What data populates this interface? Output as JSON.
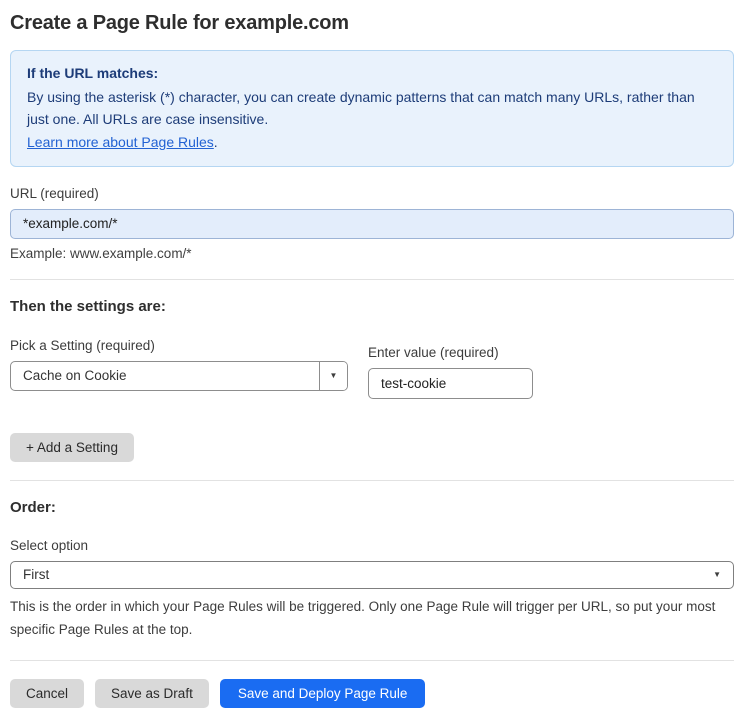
{
  "page": {
    "title": "Create a Page Rule for example.com"
  },
  "info_box": {
    "heading": "If the URL matches:",
    "body": "By using the asterisk (*) character, you can create dynamic patterns that can match many URLs, rather than just one. All URLs are case insensitive.",
    "link_label": "Learn more about Page Rules",
    "link_suffix": "."
  },
  "url_field": {
    "label": "URL (required)",
    "value": "*example.com/*",
    "helper": "Example: www.example.com/*"
  },
  "settings_section": {
    "heading": "Then the settings are:",
    "setting_picker": {
      "label": "Pick a Setting (required)",
      "selected": "Cache on Cookie"
    },
    "value_field": {
      "label": "Enter value (required)",
      "value": "test-cookie"
    },
    "add_setting_label": "+ Add a Setting"
  },
  "order_section": {
    "heading": "Order:",
    "select_label": "Select option",
    "selected": "First",
    "helper": "This is the order in which your Page Rules will be triggered. Only one Page Rule will trigger per URL, so put your most specific Page Rules at the top."
  },
  "footer": {
    "cancel_label": "Cancel",
    "save_draft_label": "Save as Draft",
    "save_deploy_label": "Save and Deploy Page Rule"
  },
  "icons": {
    "dropdown_arrow": "▼"
  },
  "colors": {
    "info_bg": "#e9f2fc",
    "info_border": "#b5d6f2",
    "info_text": "#1d3c78",
    "link": "#2262d3",
    "url_input_bg": "#e3edfb",
    "url_input_border": "#9db4d6",
    "primary_button": "#1a6cf2",
    "gray_button": "#d9d9d9"
  }
}
